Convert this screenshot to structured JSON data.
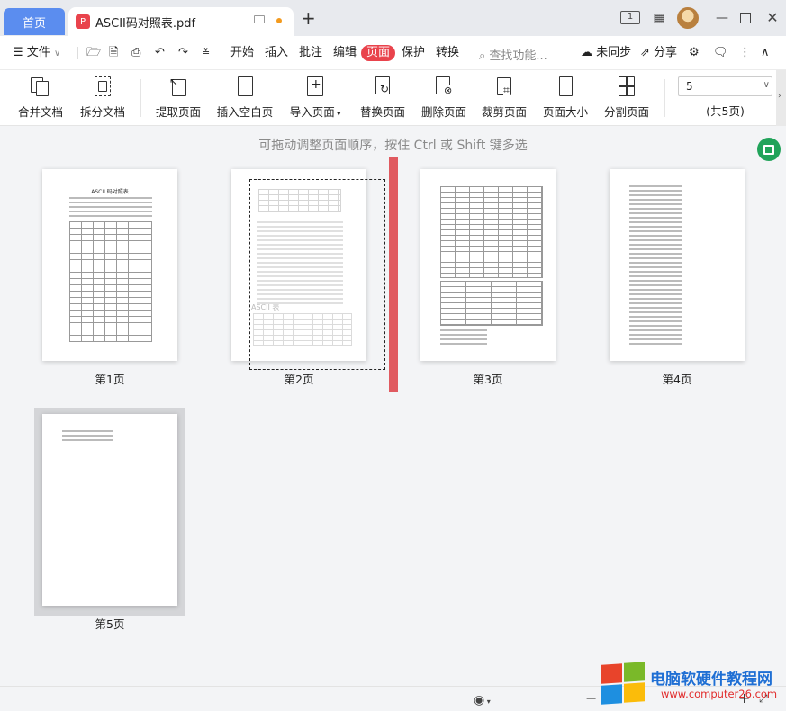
{
  "tabs": {
    "home": "首页",
    "document": "ASCII码对照表.pdf",
    "new_tab": "+"
  },
  "titlebar": {
    "page_count_badge": "1"
  },
  "menu": {
    "file": "文件",
    "items": [
      "开始",
      "插入",
      "批注",
      "编辑",
      "页面",
      "保护",
      "转换"
    ],
    "active": "页面",
    "search_placeholder": "查找功能...",
    "sync": "未同步",
    "share": "分享"
  },
  "toolbar": {
    "merge": "合并文档",
    "split": "拆分文档",
    "extract": "提取页面",
    "insert_blank": "插入空白页",
    "import": "导入页面",
    "replace": "替换页面",
    "delete": "删除页面",
    "crop": "裁剪页面",
    "page_size": "页面大小",
    "divide": "分割页面",
    "current_page": "5",
    "total_pages": "(共5页)"
  },
  "content": {
    "hint": "可拖动调整页面顺序，按住 Ctrl 或 Shift 键多选",
    "page1_title": "ASCII 码对照表",
    "page2_section": "ASCII 表",
    "pages": [
      {
        "label": "第1页"
      },
      {
        "label": "第2页"
      },
      {
        "label": "第3页"
      },
      {
        "label": "第4页"
      },
      {
        "label": "第5页"
      }
    ]
  },
  "watermark": {
    "title": "电脑软硬件教程网",
    "url": "www.computer26.com"
  },
  "colors": {
    "accent": "#e9434c",
    "home_tab": "#5b8def",
    "drop_indicator": "#e05a60",
    "green_button": "#21a35a"
  }
}
